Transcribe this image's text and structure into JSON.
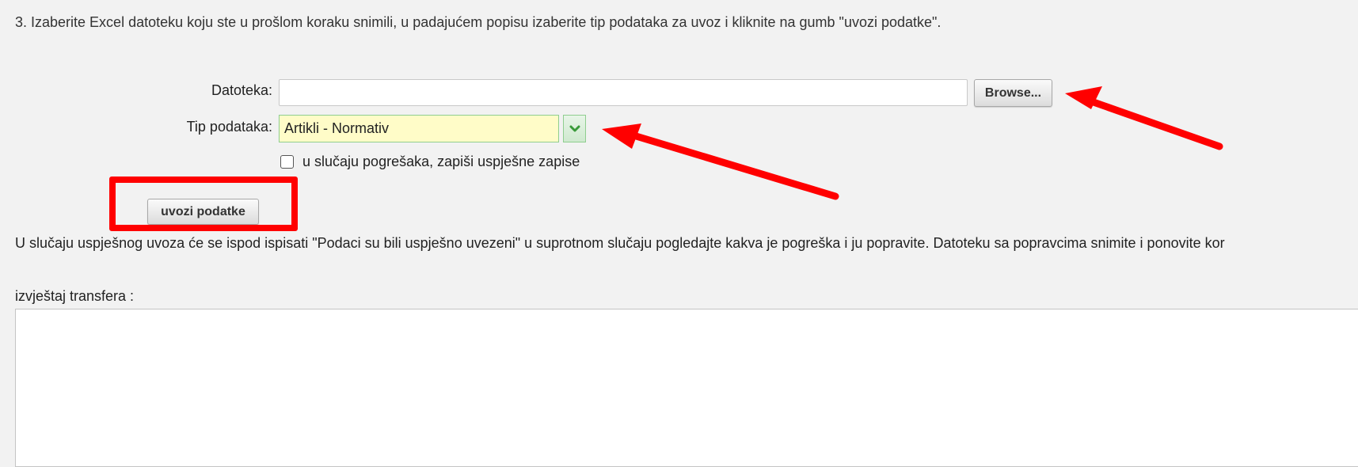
{
  "instruction": "3. Izaberite Excel datoteku koju ste u prošlom koraku snimili, u padajućem popisu izaberite tip podataka za uvoz i kliknite na gumb \"uvozi podatke\".",
  "form": {
    "file_label": "Datoteka:",
    "file_value": "",
    "browse_label": "Browse...",
    "type_label": "Tip podataka:",
    "type_selected": "Artikli - Normativ",
    "checkbox_label": "u slučaju pogrešaka, zapiši uspješne zapise",
    "checkbox_checked": false,
    "import_label": "uvozi podatke"
  },
  "result_text": "U slučaju uspješnog uvoza će se ispod ispisati \"Podaci su bili uspješno uvezeni\" u suprotnom slučaju pogledajte kakva je pogreška i ju popravite. Datoteku sa popravcima snimite i ponovite kor",
  "report": {
    "label": "izvještaj transfera :",
    "value": ""
  },
  "colors": {
    "annotation_red": "#ff0000",
    "select_bg": "#fffcc8",
    "select_border": "#8fce8f",
    "arrow_icon": "#3a9a3a"
  },
  "icons": {
    "dropdown": "chevron-down-icon"
  }
}
